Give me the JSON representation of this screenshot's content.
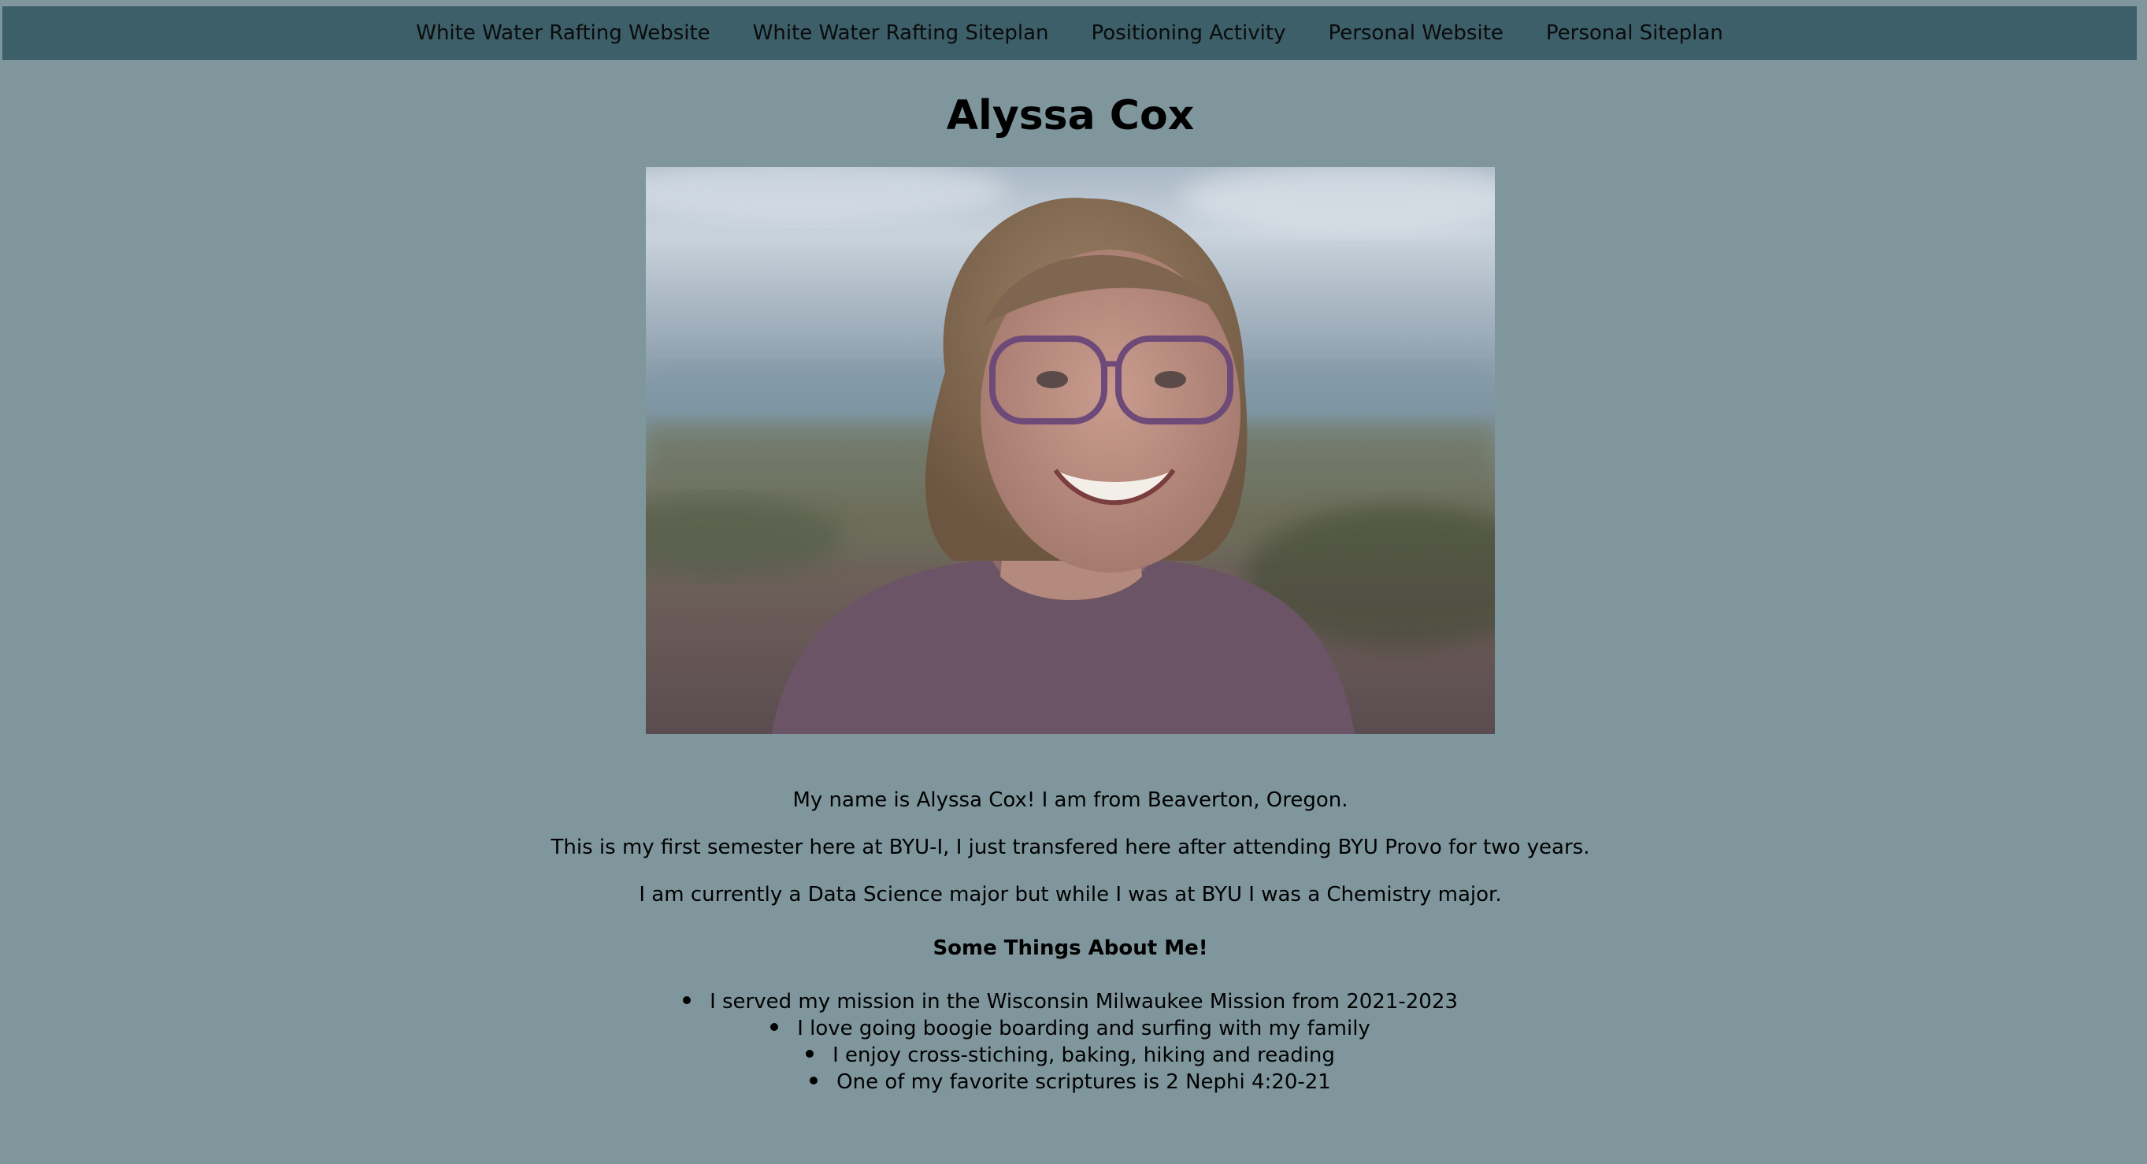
{
  "nav": {
    "links": [
      {
        "label": "White Water Rafting Website"
      },
      {
        "label": "White Water Rafting Siteplan"
      },
      {
        "label": "Positioning Activity"
      },
      {
        "label": "Personal Website"
      },
      {
        "label": "Personal Siteplan"
      }
    ]
  },
  "page": {
    "title": "Alyssa Cox"
  },
  "profile_photo": {
    "icon": "portrait-photo"
  },
  "about": {
    "paragraphs": [
      "My name is Alyssa Cox! I am from Beaverton, Oregon.",
      "This is my first semester here at BYU-I, I just transfered here after attending BYU Provo for two years.",
      "I am currently a Data Science major but while I was at BYU I was a Chemistry major."
    ],
    "heading": "Some Things About Me!",
    "things": [
      "I served my mission in the Wisconsin Milwaukee Mission from 2021-2023",
      "I love going boogie boarding and surfing with my family",
      "I enjoy cross-stiching, baking, hiking and reading",
      "One of my favorite scriptures is 2 Nephi 4:20-21"
    ]
  },
  "colors": {
    "background": "#7f969d",
    "nav_bar": "#3c5f69",
    "text": "#000000"
  }
}
